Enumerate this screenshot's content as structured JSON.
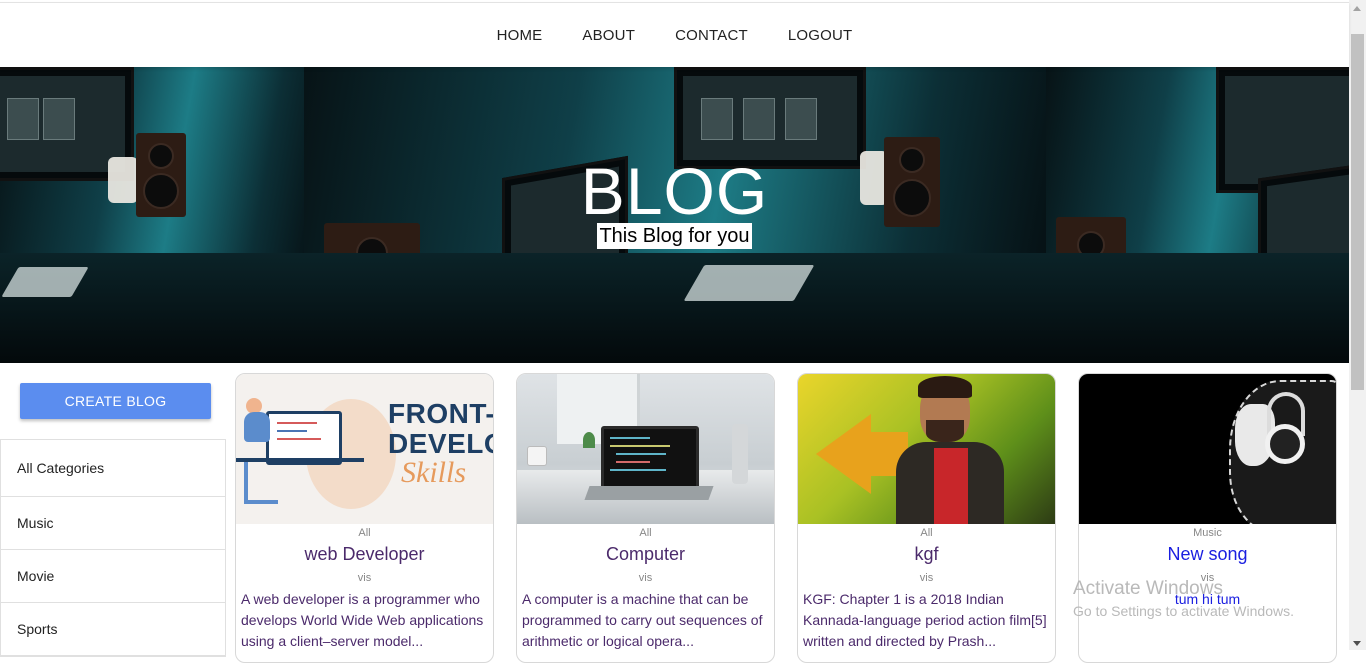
{
  "nav": {
    "items": [
      "HOME",
      "ABOUT",
      "CONTACT",
      "LOGOUT"
    ]
  },
  "hero": {
    "title": "BLOG",
    "subtitle": "This Blog for you"
  },
  "sidebar": {
    "create_label": "CREATE BLOG",
    "categories": [
      "All Categories",
      "Music",
      "Movie",
      "Sports"
    ]
  },
  "posts": [
    {
      "category": "All",
      "title": "web Developer",
      "user": "vis",
      "description": "A web developer is a programmer who develops World Wide Web applications using a client–server model...",
      "image_text_1": "FRONT-END",
      "image_text_2": "DEVELOPER",
      "image_text_3": "Skills"
    },
    {
      "category": "All",
      "title": "Computer",
      "user": "vis",
      "description": "A computer is a machine that can be programmed to carry out sequences of arithmetic or logical opera..."
    },
    {
      "category": "All",
      "title": "kgf",
      "user": "vis",
      "description": "KGF: Chapter 1 is a 2018 Indian Kannada-language period action film[5] written and directed by Prash..."
    },
    {
      "category": "Music",
      "title": "New song",
      "user": "vis",
      "description": "tum hi tum"
    }
  ],
  "watermark": {
    "title": "Activate Windows",
    "subtitle": "Go to Settings to activate Windows."
  },
  "colors": {
    "button": "#5b8def",
    "post_text": "#4b2a6b",
    "link_blue": "#1a1ee0"
  }
}
